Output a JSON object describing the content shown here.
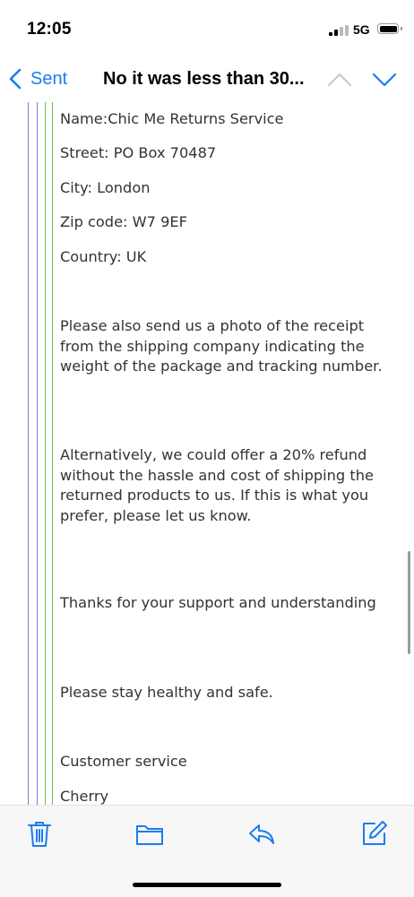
{
  "status_bar": {
    "time": "12:05",
    "network": "5G"
  },
  "nav": {
    "back_label": "Sent",
    "title": "No it was less than 30..."
  },
  "email": {
    "paragraphs": [
      "Name:Chic Me Returns Service",
      "Street: PO Box 70487",
      "City: London",
      "Zip code: W7 9EF",
      "Country: UK",
      "Please also send us a photo of the receipt from the shipping company indicating the weight of the package and tracking number.",
      "Alternatively, we could offer a 20% refund without the hassle and cost of shipping the returned products to us. If this is what you prefer, please let us know.",
      "Thanks for your support and understanding",
      "Please stay healthy and safe.",
      "Customer service",
      "Cherry"
    ]
  },
  "toolbar": {
    "icons": [
      "trash-icon",
      "folder-icon",
      "reply-icon",
      "compose-icon"
    ]
  },
  "colors": {
    "accent": "#1a7cf0",
    "quote_outer": "#7b7fd0",
    "quote_inner": "#66c24a",
    "body_text": "#333333"
  }
}
